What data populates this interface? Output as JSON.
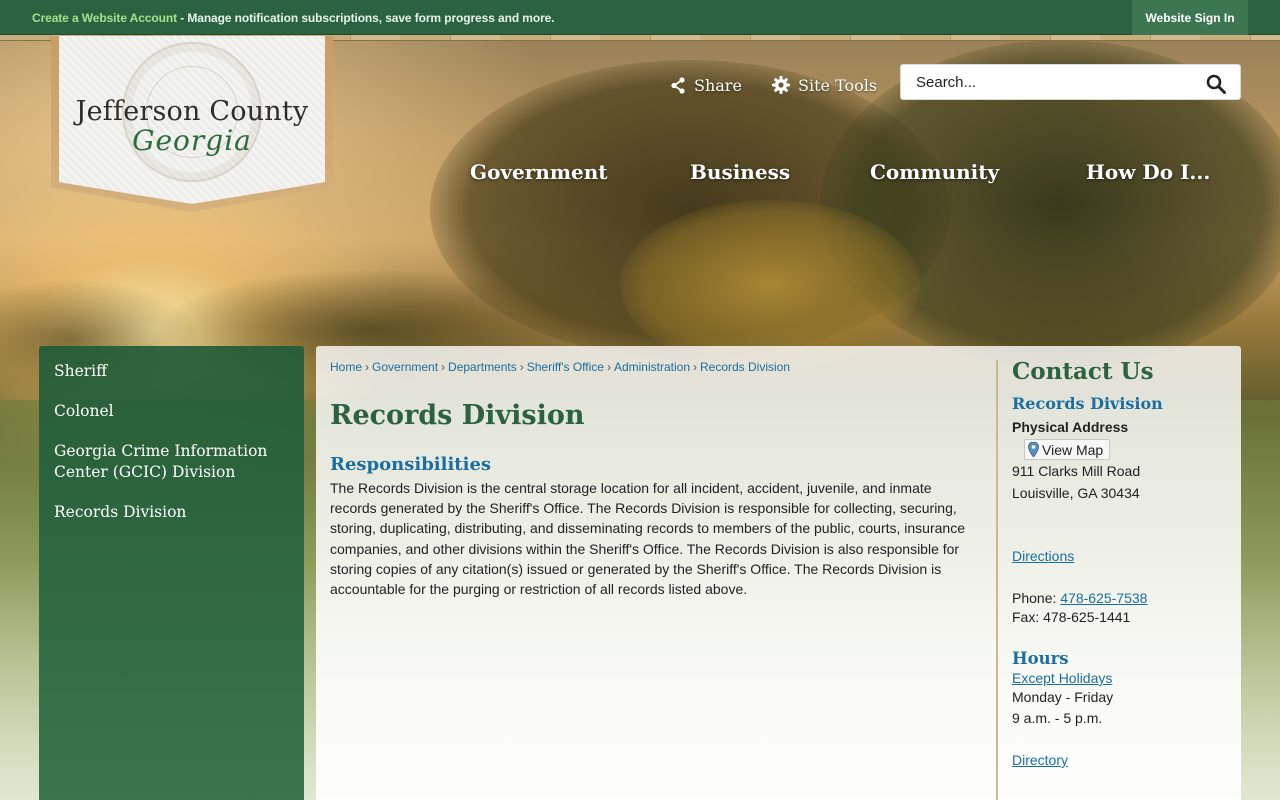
{
  "topbar": {
    "create_account": "Create a Website Account",
    "message": " - Manage notification subscriptions, save form progress and more.",
    "sign_in": "Website Sign In"
  },
  "logo": {
    "title": "Jefferson County",
    "subtitle": "Georgia"
  },
  "header": {
    "share": "Share",
    "site_tools": "Site Tools",
    "search_placeholder": "Search..."
  },
  "nav": [
    "Government",
    "Business",
    "Community",
    "How Do I..."
  ],
  "sidebar": {
    "items": [
      "Sheriff",
      "Colonel",
      "Georgia Crime Information Center (GCIC) Division",
      "Records Division"
    ]
  },
  "breadcrumb": [
    "Home",
    "Government",
    "Departments",
    "Sheriff's Office",
    "Administration",
    "Records Division"
  ],
  "page": {
    "title": "Records Division",
    "section_heading": "Responsibilities",
    "body": "The Records Division is the central storage location for all incident, accident, juvenile, and inmate records generated by the Sheriff's Office. The Records Division is responsible for collecting, securing, storing, duplicating, distributing, and disseminating records to members of the public, courts, insurance companies, and other divisions within the Sheriff's Office. The Records Division is also responsible for storing copies of any citation(s) issued or generated by the Sheriff's Office. The Records Division is accountable for the purging or restriction of all records listed above."
  },
  "contact": {
    "heading": "Contact Us",
    "name": "Records Division",
    "physical_address_label": "Physical Address",
    "view_map": "View Map",
    "address_line1": "911 Clarks Mill Road",
    "address_line2": "Louisville, GA 30434",
    "directions": "Directions",
    "phone_label": "Phone: ",
    "phone": "478-625-7538",
    "fax": "Fax: 478-625-1441",
    "hours_heading": "Hours",
    "except_holidays": "Except Holidays",
    "days": "Monday - Friday",
    "hours": "9 a.m. - 5 p.m.",
    "directory": "Directory"
  }
}
